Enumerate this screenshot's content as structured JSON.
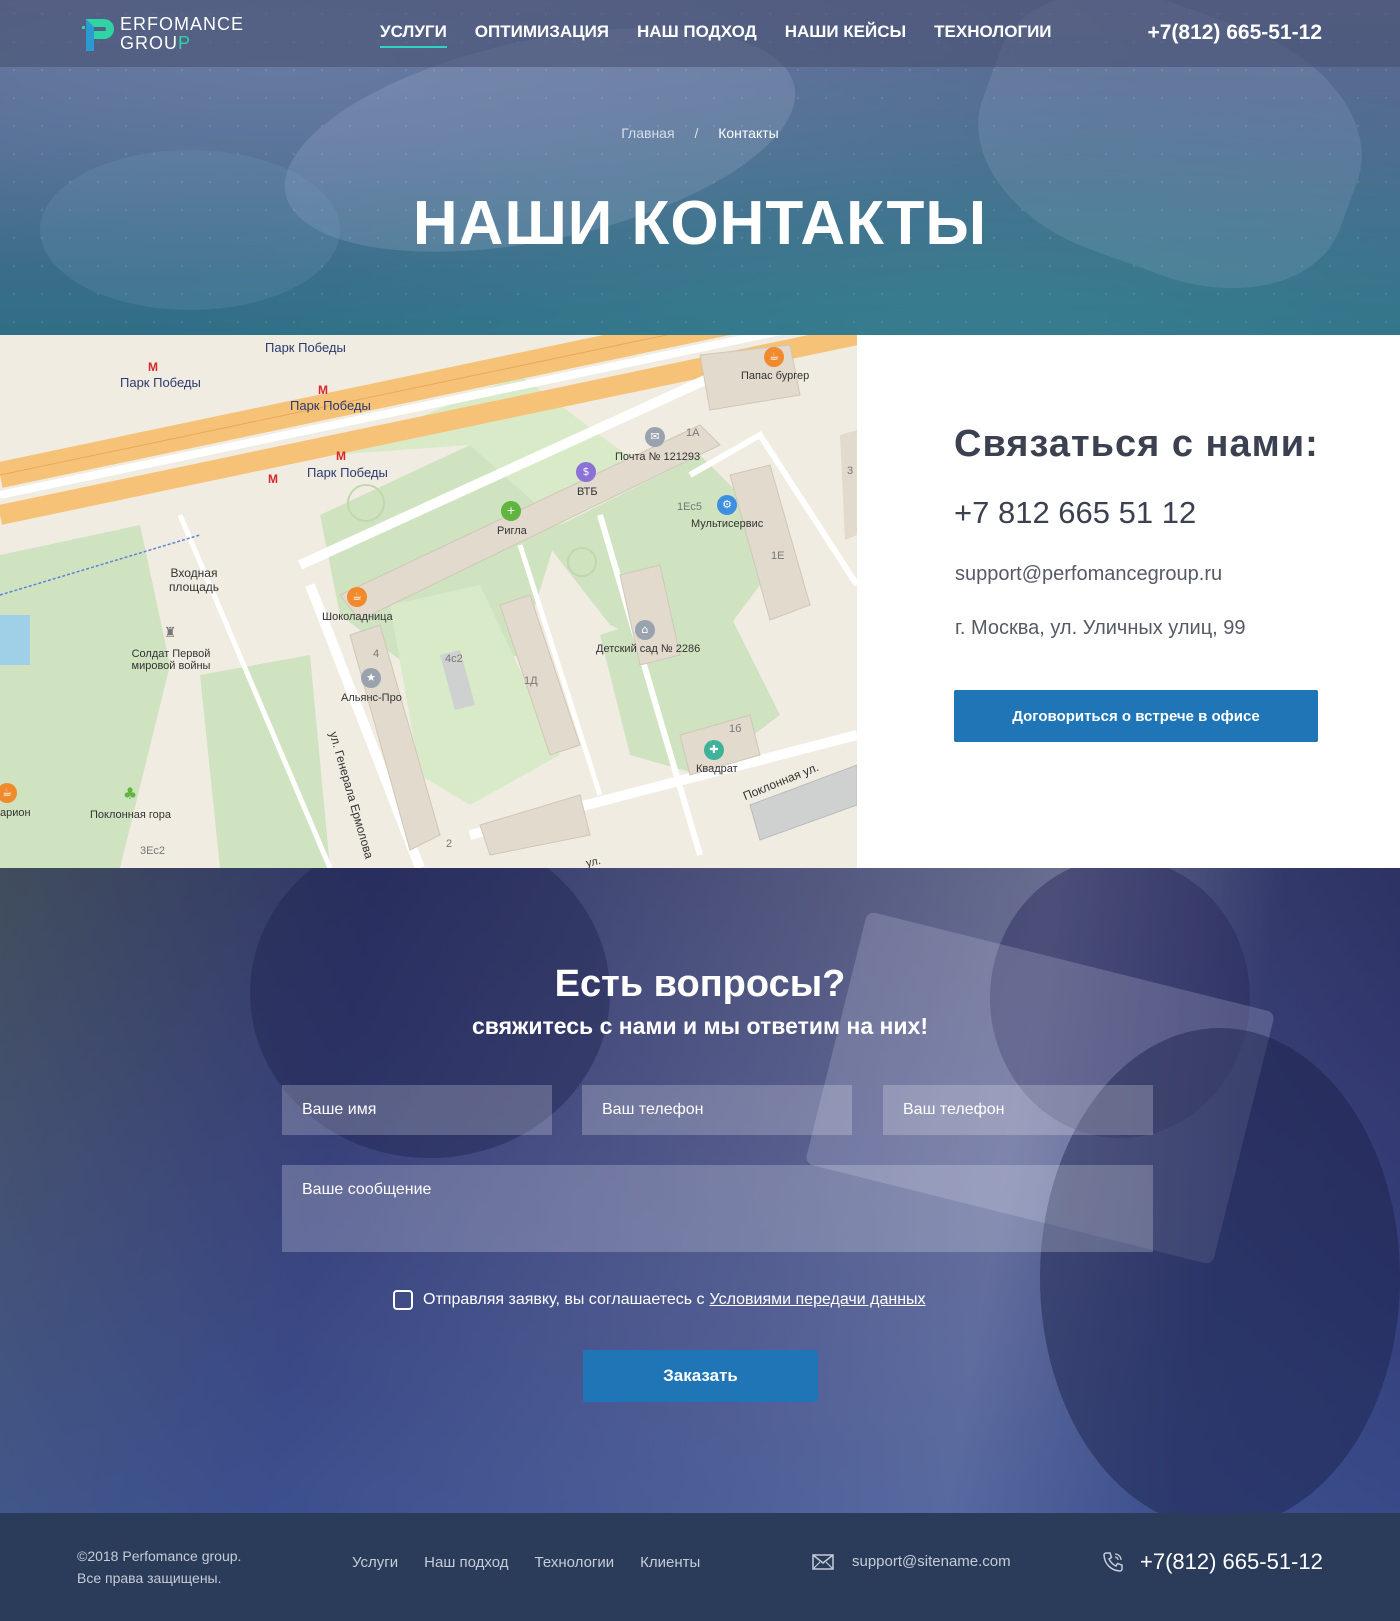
{
  "header": {
    "logo": {
      "line1": "ERFOMANCE",
      "line2_a": "GROU",
      "line2_b": "P"
    },
    "nav": [
      "УСЛУГИ",
      "ОПТИМИЗАЦИЯ",
      "НАШ ПОДХОД",
      "НАШИ КЕЙСЫ",
      "ТЕХНОЛОГИИ"
    ],
    "active_nav": "УСЛУГИ",
    "phone": "+7(812) 665-51-12"
  },
  "breadcrumb": {
    "home": "Главная",
    "separator": "/",
    "current": "Контакты"
  },
  "page_title": "НАШИ КОНТАКТЫ",
  "map": {
    "labels": {
      "park1": "Парк Победы",
      "park2": "Парк Победы",
      "park3": "Парк Победы",
      "park4": "Парк Победы",
      "papas": "Папас бургер",
      "post": "Почта № 121293",
      "b1a": "1А",
      "vtb": "ВТБ",
      "b1c5": "1Ес5",
      "multi": "Мультисервис",
      "rigla": "Ригла",
      "entry": "Входная\nплощадь",
      "b1e": "1Е",
      "choc": "Шоколадница",
      "kinder": "Детский сад № 2286",
      "soldier": "Солдат Первой\nмировой войны",
      "b4": "4",
      "b4c2": "4с2",
      "b1d": "1Д",
      "alliance": "Альянс-Про",
      "street1": "ул. Генерала Ермолова",
      "b1b": "1б",
      "kvadrat": "Квадрат",
      "poklon_st": "Поклонная ул.",
      "arion": "арион",
      "poklon_hill": "Поклонная гора",
      "b3e": "3Ес2",
      "b2": "2",
      "b3": "3",
      "ul": "ул."
    },
    "metro_symbol": "М"
  },
  "contact": {
    "title": "Связаться с нами:",
    "phone": "+7 812 665 51 12",
    "email": "support@perfomancegroup.ru",
    "address": "г. Москва, ул. Уличных улиц, 99",
    "button": "Договориться о встрече в офисе"
  },
  "form": {
    "heading": "Есть вопросы?",
    "subheading": "свяжитесь с нами и мы ответим на них!",
    "name_placeholder": "Ваше имя",
    "phone_placeholder": "Ваш телефон",
    "phone2_placeholder": "Ваш телефон",
    "message_placeholder": "Ваше сообщение",
    "consent_text": "Отправляя заявку, вы соглашаетесь с",
    "consent_link": "Условиями передачи данных",
    "submit": "Заказать"
  },
  "footer": {
    "copyright_line1": "©2018 Perfomance group.",
    "copyright_line2": "Все права защищены.",
    "nav": [
      "Услуги",
      "Наш подход",
      "Технологии",
      "Клиенты"
    ],
    "email": "support@sitename.com",
    "phone": "+7(812) 665-51-12"
  },
  "colors": {
    "accent": "#1f75b6",
    "logo_green": "#2fd3a4",
    "footer_bg": "#2b3c5a",
    "title_dark": "#3b4150"
  }
}
